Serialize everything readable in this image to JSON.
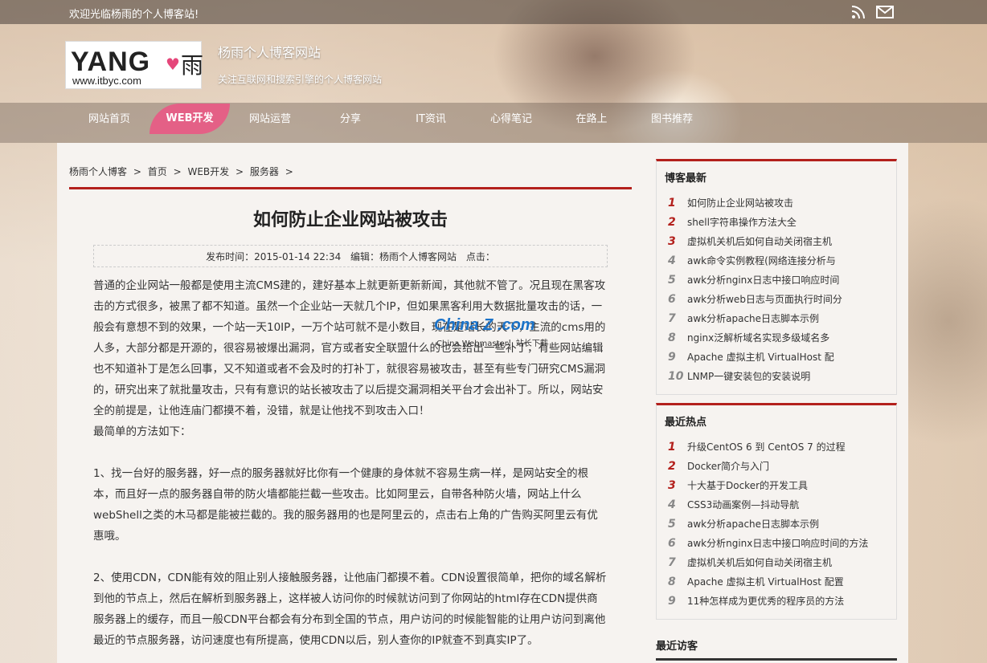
{
  "topbar": {
    "welcome": "欢迎光临杨雨的个人博客站!"
  },
  "logo": {
    "wordmark": "YANG",
    "han": "雨",
    "url": "www.itbyc.com"
  },
  "site": {
    "title": "杨雨个人博客网站",
    "subtitle": "关注互联网和搜索引擎的个人博客网站"
  },
  "nav": [
    "网站首页",
    "WEB开发",
    "网站运营",
    "分享",
    "IT资讯",
    "心得笔记",
    "在路上",
    "图书推荐"
  ],
  "breadcrumb": [
    "杨雨个人博客",
    ">",
    "首页",
    ">",
    "WEB开发",
    ">",
    "服务器",
    ">"
  ],
  "article": {
    "title": "如何防止企业网站被攻击",
    "meta": {
      "published": "发布时间：2015-01-14 22:34",
      "editor": "编辑：杨雨个人博客网站",
      "clicks": "点击："
    },
    "paragraphs": [
      "普通的企业网站一般都是使用主流CMS建的，建好基本上就更新更新新闻，其他就不管了。况且现在黑客攻击的方式很多，被黑了都不知道。虽然一个企业站一天就几个IP，但如果黑客利用大数据批量攻击的话，一般会有意想不到的效果，一个站一天10IP，一万个站可就不是小数目，现在是站长的天下，主流的cms用的人多，大部分都是开源的，很容易被爆出漏洞，官方或者安全联盟什么的也会给出一些补丁，有些网站编辑也不知道补丁是怎么回事，又不知道或者不会及时的打补丁，就很容易被攻击，甚至有些专门研究CMS漏洞的，研究出来了就批量攻击，只有有意识的站长被攻击了以后提交漏洞相关平台才会出补丁。所以，网站安全的前提是，让他连庙门都摸不着，没错，就是让他找不到攻击入口！",
      "最简单的方法如下：",
      "",
      "1、找一台好的服务器，好一点的服务器就好比你有一个健康的身体就不容易生病一样，是网站安全的根本，而且好一点的服务器自带的防火墙都能拦截一些攻击。比如阿里云，自带各种防火墙，网站上什么webShell之类的木马都是能被拦截的。我的服务器用的也是阿里云的，点击右上角的广告购买阿里云有优惠哦。",
      "",
      "2、使用CDN，CDN能有效的阻止别人接触服务器，让他庙门都摸不着。CDN设置很简单，把你的域名解析到他的节点上，然后在解析到服务器上，这样被人访问你的时候就访问到了你网站的html存在CDN提供商服务器上的缓存，而且一般CDN平台都会有分布到全国的节点，用户访问的时候能智能的让用户访问到离他最近的节点服务器，访问速度也有所提高，使用CDN以后，别人查你的IP就查不到真实IP了。"
    ]
  },
  "watermark": {
    "brand": "China Z .com",
    "sub": "China Webmaster！站长下载"
  },
  "sidebar": {
    "latest": {
      "title": "博客最新",
      "items": [
        {
          "num": "1",
          "text": "如何防止企业网站被攻击"
        },
        {
          "num": "2",
          "text": "shell字符串操作方法大全"
        },
        {
          "num": "3",
          "text": "虚拟机关机后如何自动关闭宿主机"
        },
        {
          "num": "4",
          "text": "awk命令实例教程(网络连接分析与"
        },
        {
          "num": "5",
          "text": "awk分析nginx日志中接口响应时间"
        },
        {
          "num": "6",
          "text": "awk分析web日志与页面执行时间分"
        },
        {
          "num": "7",
          "text": "awk分析apache日志脚本示例"
        },
        {
          "num": "8",
          "text": "nginx泛解析域名实现多级域名多"
        },
        {
          "num": "9",
          "text": "Apache 虚拟主机 VirtualHost 配"
        },
        {
          "num": "10",
          "text": "LNMP一键安装包的安装说明"
        }
      ]
    },
    "hot": {
      "title": "最近热点",
      "items": [
        {
          "num": "1",
          "text": "升级CentOS 6 到 CentOS 7 的过程"
        },
        {
          "num": "2",
          "text": "Docker简介与入门"
        },
        {
          "num": "3",
          "text": "十大基于Docker的开发工具"
        },
        {
          "num": "4",
          "text": "CSS3动画案例—抖动导航"
        },
        {
          "num": "5",
          "text": "awk分析apache日志脚本示例"
        },
        {
          "num": "6",
          "text": "awk分析nginx日志中接口响应时间的方法"
        },
        {
          "num": "7",
          "text": "虚拟机关机后如何自动关闭宿主机"
        },
        {
          "num": "8",
          "text": "Apache 虚拟主机 VirtualHost 配置"
        },
        {
          "num": "9",
          "text": "11种怎样成为更优秀的程序员的方法"
        }
      ]
    },
    "visitors": {
      "title": "最近访客"
    }
  },
  "colors": {
    "accent": "#b3201c",
    "nav_active": "#e46086",
    "link": "#333333"
  },
  "icons": {
    "rss": "rss-icon",
    "mail": "mail-icon"
  }
}
